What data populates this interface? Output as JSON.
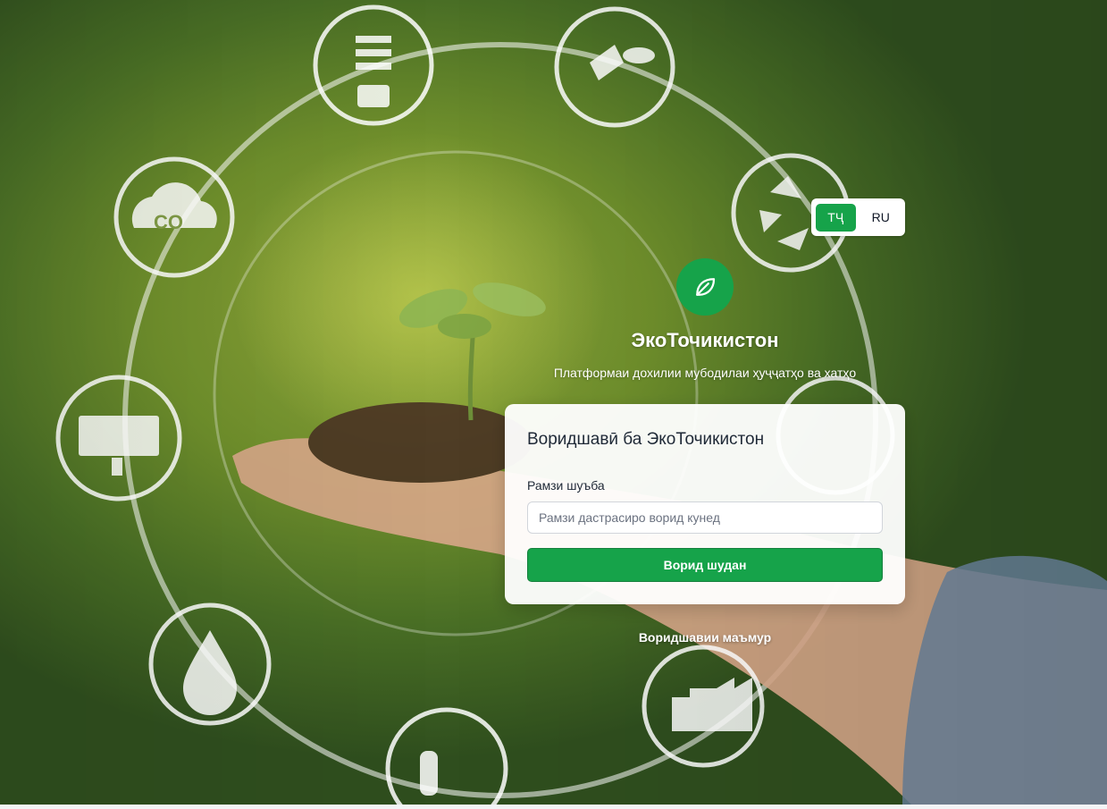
{
  "language_switch": {
    "options": [
      {
        "label": "ТҶ",
        "active": true
      },
      {
        "label": "RU",
        "active": false
      }
    ]
  },
  "brand": {
    "logo_icon": "leaf-icon",
    "title": "ЭкоТочикистон",
    "subtitle": "Платформаи дохилии мубодилаи ҳуҷҷатҳо ва хатҳо"
  },
  "login_card": {
    "title": "Воридшавӣ ба ЭкоТочикистон",
    "code_label": "Рамзи шуъба",
    "code_placeholder": "Рамзи дастрасиро ворид кунед",
    "code_value": "",
    "submit_label": "Ворид шудан"
  },
  "admin_link": "Воридшавии маъмур",
  "background": {
    "icons": [
      "lightbulb-icon",
      "plug-leaf-icon",
      "recycle-icon",
      "wind-turbine-icon",
      "factory-leaf-icon",
      "lab-flask-icon",
      "water-drop-icon",
      "solar-panel-icon",
      "co2-cloud-icon"
    ]
  },
  "colors": {
    "accent": "#16a34a",
    "card_bg": "#ffffff",
    "text_dark": "#1f2937"
  }
}
